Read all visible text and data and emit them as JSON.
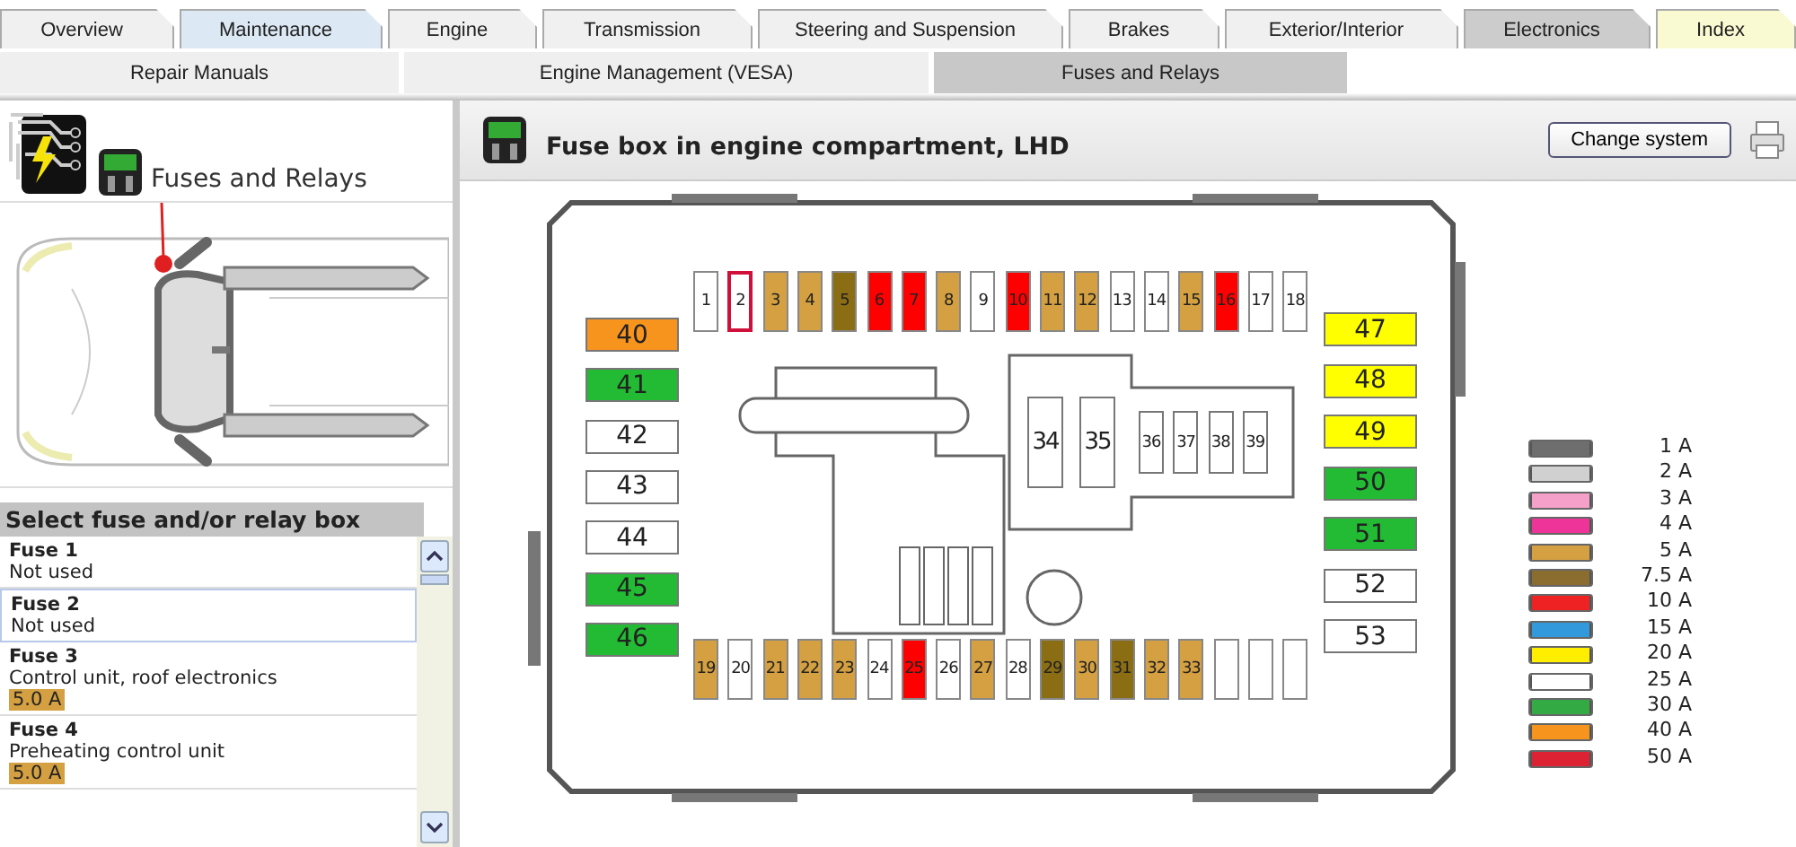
{
  "tabs": [
    {
      "label": "Overview",
      "color": "#f0f0f0"
    },
    {
      "label": "Maintenance",
      "color": "#dce8f4"
    },
    {
      "label": "Engine",
      "color": "#f0f0f0"
    },
    {
      "label": "Transmission",
      "color": "#f0f0f0"
    },
    {
      "label": "Steering and Suspension",
      "color": "#f0f0f0"
    },
    {
      "label": "Brakes",
      "color": "#f0f0f0"
    },
    {
      "label": "Exterior/Interior",
      "color": "#f0f0f0"
    },
    {
      "label": "Electronics",
      "color": "#cccccc"
    },
    {
      "label": "Index",
      "color": "#fafad2"
    }
  ],
  "subtabs": [
    {
      "label": "Repair Manuals",
      "selected": false
    },
    {
      "label": "Engine Management (VESA)",
      "selected": false
    },
    {
      "label": "Fuses and Relays",
      "selected": true
    }
  ],
  "sidebar": {
    "title": "Fuses and Relays",
    "list_title": "Select fuse and/or relay box",
    "items": [
      {
        "name": "Fuse 1",
        "description": "Not used",
        "selected": false
      },
      {
        "name": "Fuse 2",
        "description": "Not used",
        "selected": true
      },
      {
        "name": "Fuse 3",
        "description": "Control unit, roof electronics",
        "rating": "5.0 A",
        "color": "#d4a041",
        "selected": false
      },
      {
        "name": "Fuse 4",
        "description": "Preheating control unit",
        "rating": "5.0 A",
        "color": "#d4a041",
        "selected": false
      }
    ]
  },
  "main": {
    "title": "Fuse box in engine compartment, LHD",
    "button": "Change system",
    "top_fuses": [
      {
        "label": "1",
        "color": "#ffffff",
        "selected": false
      },
      {
        "label": "2",
        "color": "#ffffff",
        "selected": true
      },
      {
        "label": "3",
        "color": "#d4a041",
        "selected": false
      },
      {
        "label": "4",
        "color": "#d4a041",
        "selected": false
      },
      {
        "label": "5",
        "color": "#8b6d14",
        "selected": false
      },
      {
        "label": "6",
        "color": "#ff0000",
        "selected": false
      },
      {
        "label": "7",
        "color": "#ff0000",
        "selected": false
      },
      {
        "label": "8",
        "color": "#d4a041",
        "selected": false
      },
      {
        "label": "9",
        "color": "#ffffff",
        "selected": false
      },
      {
        "label": "10",
        "color": "#ff0000",
        "selected": false
      },
      {
        "label": "11",
        "color": "#d4a041",
        "selected": false
      },
      {
        "label": "12",
        "color": "#d4a041",
        "selected": false
      },
      {
        "label": "13",
        "color": "#ffffff",
        "selected": false
      },
      {
        "label": "14",
        "color": "#ffffff",
        "selected": false
      },
      {
        "label": "15",
        "color": "#d4a041",
        "selected": false
      },
      {
        "label": "16",
        "color": "#ff0000",
        "selected": false
      },
      {
        "label": "17",
        "color": "#ffffff",
        "selected": false
      },
      {
        "label": "18",
        "color": "#ffffff",
        "selected": false
      }
    ],
    "bottom_fuses": [
      {
        "label": "19",
        "color": "#d4a041",
        "selected": false
      },
      {
        "label": "20",
        "color": "#ffffff",
        "selected": false
      },
      {
        "label": "21",
        "color": "#d4a041",
        "selected": false
      },
      {
        "label": "22",
        "color": "#d4a041",
        "selected": false
      },
      {
        "label": "23",
        "color": "#d4a041",
        "selected": false
      },
      {
        "label": "24",
        "color": "#ffffff",
        "selected": false
      },
      {
        "label": "25",
        "color": "#ff0000",
        "selected": false
      },
      {
        "label": "26",
        "color": "#ffffff",
        "selected": false
      },
      {
        "label": "27",
        "color": "#d4a041",
        "selected": false
      },
      {
        "label": "28",
        "color": "#ffffff",
        "selected": false
      },
      {
        "label": "29",
        "color": "#8b6d14",
        "selected": false
      },
      {
        "label": "30",
        "color": "#d4a041",
        "selected": false
      },
      {
        "label": "31",
        "color": "#8b6d14",
        "selected": false
      },
      {
        "label": "32",
        "color": "#d4a041",
        "selected": false
      },
      {
        "label": "33",
        "color": "#d4a041",
        "selected": false
      },
      {
        "color": "#ffffff",
        "selected": false
      },
      {
        "color": "#ffffff",
        "selected": false
      },
      {
        "color": "#ffffff",
        "selected": false
      }
    ],
    "left_fuses": [
      {
        "label": "40",
        "color": "#f7941d",
        "selected": false
      },
      {
        "label": "41",
        "color": "#22bb33",
        "selected": false
      },
      {
        "label": "42",
        "color": "#ffffff",
        "selected": false
      },
      {
        "label": "43",
        "color": "#ffffff",
        "selected": false
      },
      {
        "label": "44",
        "color": "#ffffff",
        "selected": false
      },
      {
        "label": "45",
        "color": "#22bb33",
        "selected": false
      },
      {
        "label": "46",
        "color": "#22bb33",
        "selected": false
      }
    ],
    "right_fuses": [
      {
        "label": "47",
        "color": "#ffff00",
        "selected": false
      },
      {
        "label": "48",
        "color": "#ffff00",
        "selected": false
      },
      {
        "label": "49",
        "color": "#ffff00",
        "selected": false
      },
      {
        "label": "50",
        "color": "#22bb33",
        "selected": false
      },
      {
        "label": "51",
        "color": "#22bb33",
        "selected": false
      },
      {
        "label": "52",
        "color": "#ffffff",
        "selected": false
      },
      {
        "label": "53",
        "color": "#ffffff",
        "selected": false
      }
    ],
    "relays": [
      {
        "label": "34",
        "kind": "large"
      },
      {
        "label": "35",
        "kind": "large"
      },
      {
        "label": "36",
        "kind": "small"
      },
      {
        "label": "37",
        "kind": "small"
      },
      {
        "label": "38",
        "kind": "small"
      },
      {
        "label": "39",
        "kind": "small"
      }
    ],
    "legend": [
      {
        "label": "1 A",
        "color": "#6e6e6e"
      },
      {
        "label": "2 A",
        "color": "#d0d0d0"
      },
      {
        "label": "3 A",
        "color": "#f4a0c8"
      },
      {
        "label": "4 A",
        "color": "#ee3399"
      },
      {
        "label": "5 A",
        "color": "#d4a041"
      },
      {
        "label": "7.5 A",
        "color": "#8b6d30"
      },
      {
        "label": "10 A",
        "color": "#ee2222"
      },
      {
        "label": "15 A",
        "color": "#3399dd"
      },
      {
        "label": "20 A",
        "color": "#ffee00"
      },
      {
        "label": "25 A",
        "color": "#ffffff"
      },
      {
        "label": "30 A",
        "color": "#33aa44"
      },
      {
        "label": "40 A",
        "color": "#f7941d"
      },
      {
        "label": "50 A",
        "color": "#dd2233"
      }
    ]
  }
}
